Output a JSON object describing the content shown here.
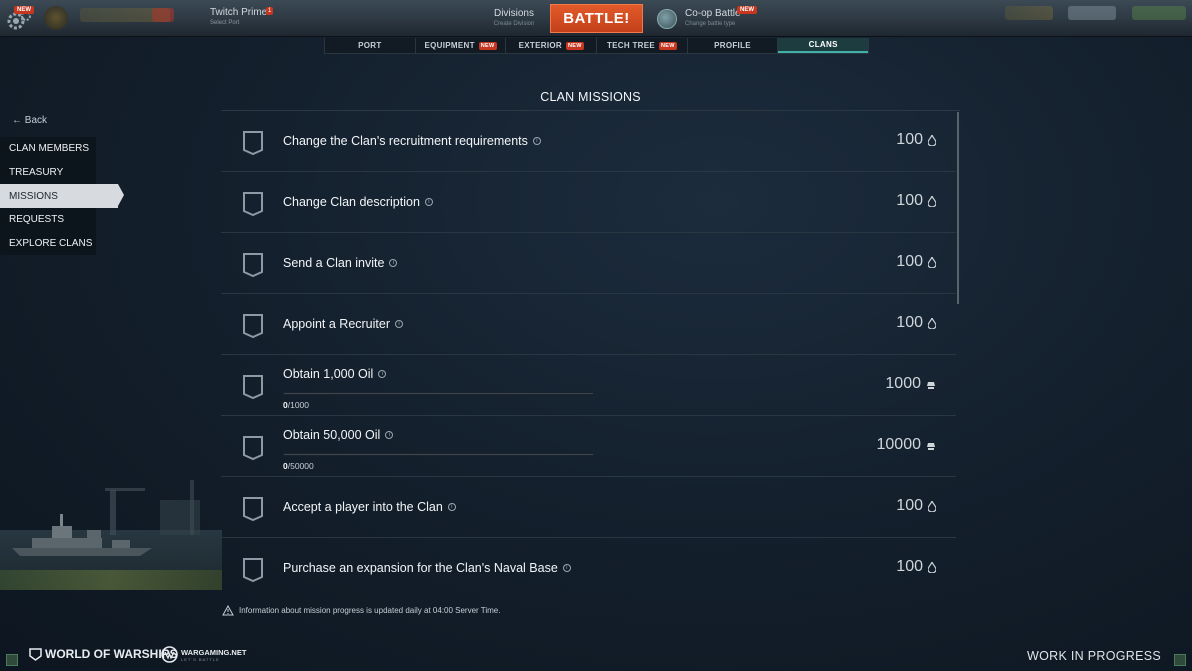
{
  "topbar": {
    "logo_new": "NEW",
    "twitch_title": "Twitch Prime",
    "twitch_badge": "1",
    "twitch_sub": "Select Port",
    "divisions_title": "Divisions",
    "divisions_sub": "Create Division",
    "battle_label": "BATTLE!",
    "coop_title": "Co-op Battle",
    "coop_badge": "NEW",
    "coop_sub": "Change battle type"
  },
  "tabs": [
    {
      "label": "PORT",
      "badge": ""
    },
    {
      "label": "EQUIPMENT",
      "badge": "NEW"
    },
    {
      "label": "EXTERIOR",
      "badge": "NEW"
    },
    {
      "label": "TECH TREE",
      "badge": "NEW"
    },
    {
      "label": "PROFILE",
      "badge": ""
    },
    {
      "label": "CLANS",
      "badge": ""
    }
  ],
  "sidebar": {
    "back_label": "Back",
    "items": [
      "CLAN MEMBERS",
      "TREASURY",
      "MISSIONS",
      "REQUESTS",
      "EXPLORE CLANS"
    ]
  },
  "main": {
    "title": "CLAN MISSIONS",
    "missions": [
      {
        "name": "Change the Clan's recruitment requirements",
        "reward": "100",
        "reward_type": "oil"
      },
      {
        "name": "Change Clan description",
        "reward": "100",
        "reward_type": "oil"
      },
      {
        "name": "Send a Clan invite",
        "reward": "100",
        "reward_type": "oil"
      },
      {
        "name": "Appoint a Recruiter",
        "reward": "100",
        "reward_type": "oil"
      },
      {
        "name": "Obtain 1,000 Oil",
        "reward": "1000",
        "reward_type": "steel",
        "progress_current": "0",
        "progress_total": "/1000",
        "progress_fraction": 0
      },
      {
        "name": "Obtain 50,000 Oil",
        "reward": "10000",
        "reward_type": "steel",
        "progress_current": "0",
        "progress_total": "/50000",
        "progress_fraction": 0
      },
      {
        "name": "Accept a player into the Clan",
        "reward": "100",
        "reward_type": "oil"
      },
      {
        "name": "Purchase an expansion for the Clan's Naval Base",
        "reward": "100",
        "reward_type": "oil"
      }
    ]
  },
  "footer": {
    "note": "Information about mission progress is updated daily at 04:00 Server Time.",
    "brand_wows": "WORLD OF WARSHIPS",
    "brand_wg": "WARGAMING.NET",
    "brand_wg_sub": "LET'S BATTLE",
    "wip": "WORK IN PROGRESS"
  },
  "colors": {
    "accent": "#3fb1a8",
    "battle": "#d84b22",
    "badge": "#c7361f"
  }
}
